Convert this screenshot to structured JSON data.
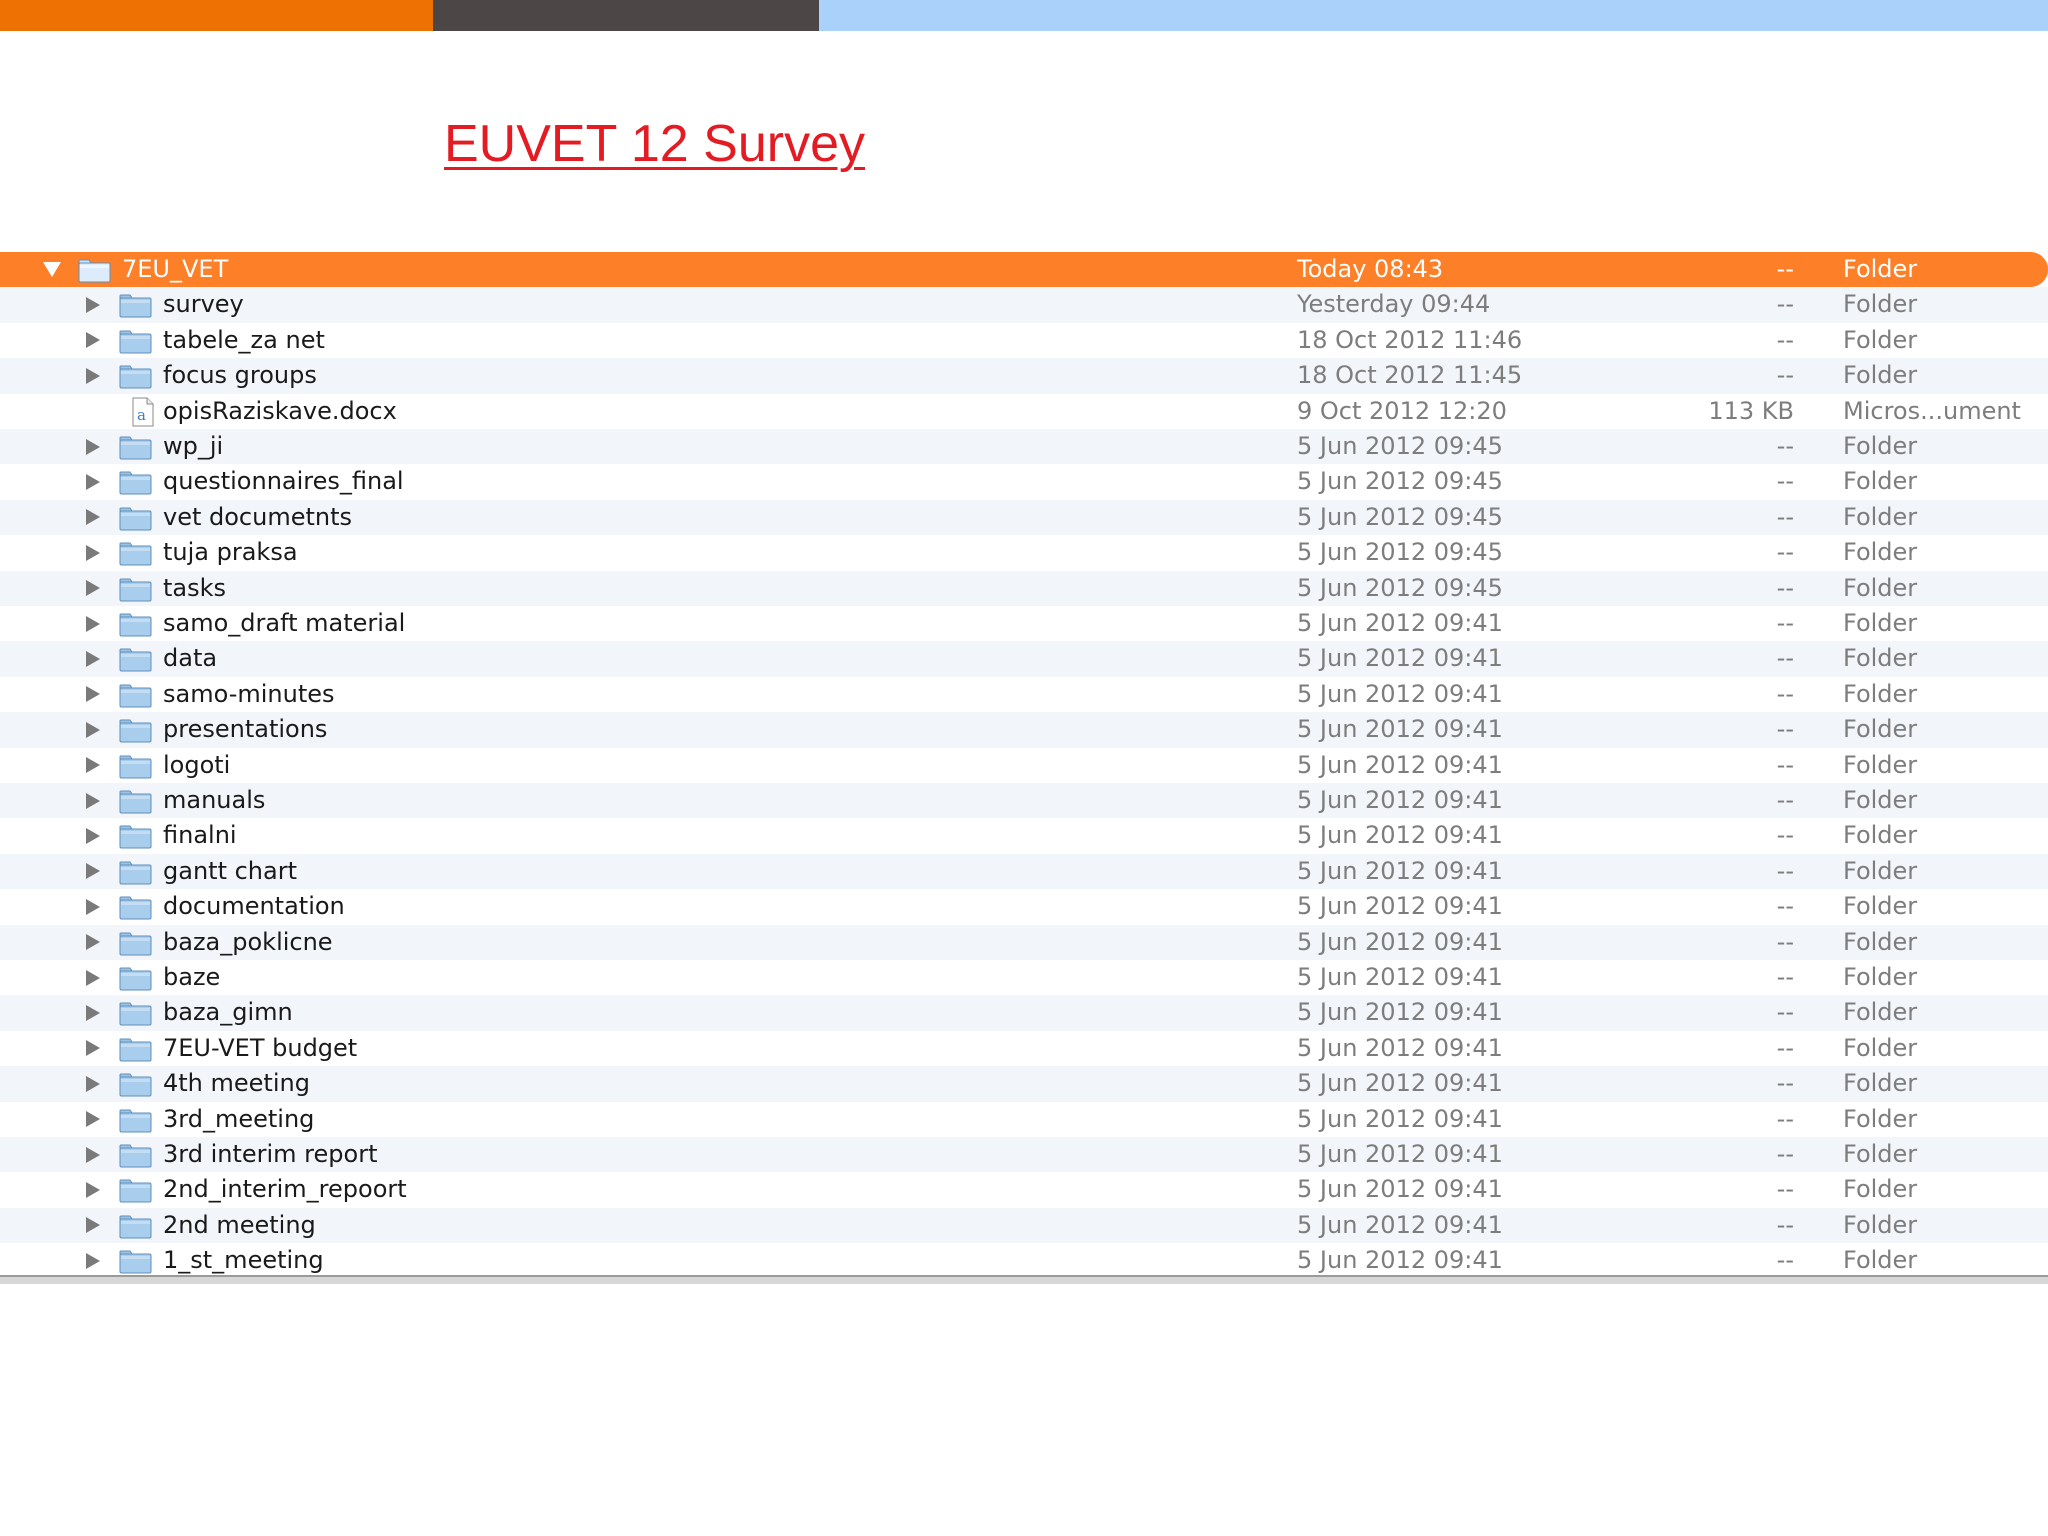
{
  "colors": {
    "bar_orange": "#ee7203",
    "bar_dark": "#4d4646",
    "bar_blue": "#a9d1fa",
    "title_red": "#e31b23",
    "selection_orange": "#fd7f27",
    "folder_blue": "#8fbde4"
  },
  "slide": {
    "title": "EUVET 12 Survey"
  },
  "finder": {
    "rows": [
      {
        "name": "7EU_VET",
        "date": "Today 08:43",
        "size": "--",
        "kind": "Folder",
        "icon": "folder-icon",
        "expanded": true,
        "selected": true,
        "level": 0
      },
      {
        "name": "survey",
        "date": "Yesterday 09:44",
        "size": "--",
        "kind": "Folder",
        "icon": "folder-icon",
        "level": 1
      },
      {
        "name": "tabele_za net",
        "date": "18 Oct 2012 11:46",
        "size": "--",
        "kind": "Folder",
        "icon": "folder-icon",
        "level": 1
      },
      {
        "name": "focus groups",
        "date": "18 Oct 2012 11:45",
        "size": "--",
        "kind": "Folder",
        "icon": "folder-icon",
        "level": 1
      },
      {
        "name": "opisRaziskave.docx",
        "date": "9 Oct 2012 12:20",
        "size": "113 KB",
        "kind": "Micros...ument",
        "icon": "document-icon",
        "level": 1,
        "file": true
      },
      {
        "name": "wp_ji",
        "date": "5 Jun 2012 09:45",
        "size": "--",
        "kind": "Folder",
        "icon": "folder-icon",
        "level": 1
      },
      {
        "name": "questionnaires_final",
        "date": "5 Jun 2012 09:45",
        "size": "--",
        "kind": "Folder",
        "icon": "folder-icon",
        "level": 1
      },
      {
        "name": "vet documetnts",
        "date": "5 Jun 2012 09:45",
        "size": "--",
        "kind": "Folder",
        "icon": "folder-icon",
        "level": 1
      },
      {
        "name": "tuja praksa",
        "date": "5 Jun 2012 09:45",
        "size": "--",
        "kind": "Folder",
        "icon": "folder-icon",
        "level": 1
      },
      {
        "name": "tasks",
        "date": "5 Jun 2012 09:45",
        "size": "--",
        "kind": "Folder",
        "icon": "folder-icon",
        "level": 1
      },
      {
        "name": "samo_draft material",
        "date": "5 Jun 2012 09:41",
        "size": "--",
        "kind": "Folder",
        "icon": "folder-icon",
        "level": 1
      },
      {
        "name": "data",
        "date": "5 Jun 2012 09:41",
        "size": "--",
        "kind": "Folder",
        "icon": "folder-icon",
        "level": 1
      },
      {
        "name": "samo-minutes",
        "date": "5 Jun 2012 09:41",
        "size": "--",
        "kind": "Folder",
        "icon": "folder-icon",
        "level": 1
      },
      {
        "name": "presentations",
        "date": "5 Jun 2012 09:41",
        "size": "--",
        "kind": "Folder",
        "icon": "folder-icon",
        "level": 1
      },
      {
        "name": "logoti",
        "date": "5 Jun 2012 09:41",
        "size": "--",
        "kind": "Folder",
        "icon": "folder-icon",
        "level": 1
      },
      {
        "name": "manuals",
        "date": "5 Jun 2012 09:41",
        "size": "--",
        "kind": "Folder",
        "icon": "folder-icon",
        "level": 1
      },
      {
        "name": "finalni",
        "date": "5 Jun 2012 09:41",
        "size": "--",
        "kind": "Folder",
        "icon": "folder-icon",
        "level": 1
      },
      {
        "name": "gantt chart",
        "date": "5 Jun 2012 09:41",
        "size": "--",
        "kind": "Folder",
        "icon": "folder-icon",
        "level": 1
      },
      {
        "name": "documentation",
        "date": "5 Jun 2012 09:41",
        "size": "--",
        "kind": "Folder",
        "icon": "folder-icon",
        "level": 1
      },
      {
        "name": "baza_poklicne",
        "date": "5 Jun 2012 09:41",
        "size": "--",
        "kind": "Folder",
        "icon": "folder-icon",
        "level": 1
      },
      {
        "name": "baze",
        "date": "5 Jun 2012 09:41",
        "size": "--",
        "kind": "Folder",
        "icon": "folder-icon",
        "level": 1
      },
      {
        "name": "baza_gimn",
        "date": "5 Jun 2012 09:41",
        "size": "--",
        "kind": "Folder",
        "icon": "folder-icon",
        "level": 1
      },
      {
        "name": "7EU-VET budget",
        "date": "5 Jun 2012 09:41",
        "size": "--",
        "kind": "Folder",
        "icon": "folder-icon",
        "level": 1
      },
      {
        "name": "4th meeting",
        "date": "5 Jun 2012 09:41",
        "size": "--",
        "kind": "Folder",
        "icon": "folder-icon",
        "level": 1
      },
      {
        "name": "3rd_meeting",
        "date": "5 Jun 2012 09:41",
        "size": "--",
        "kind": "Folder",
        "icon": "folder-icon",
        "level": 1
      },
      {
        "name": "3rd interim report",
        "date": "5 Jun 2012 09:41",
        "size": "--",
        "kind": "Folder",
        "icon": "folder-icon",
        "level": 1
      },
      {
        "name": "2nd_interim_repoort",
        "date": "5 Jun 2012 09:41",
        "size": "--",
        "kind": "Folder",
        "icon": "folder-icon",
        "level": 1
      },
      {
        "name": "2nd meeting",
        "date": "5 Jun 2012 09:41",
        "size": "--",
        "kind": "Folder",
        "icon": "folder-icon",
        "level": 1
      },
      {
        "name": "1_st_meeting",
        "date": "5 Jun 2012 09:41",
        "size": "--",
        "kind": "Folder",
        "icon": "folder-icon",
        "level": 1
      }
    ]
  }
}
